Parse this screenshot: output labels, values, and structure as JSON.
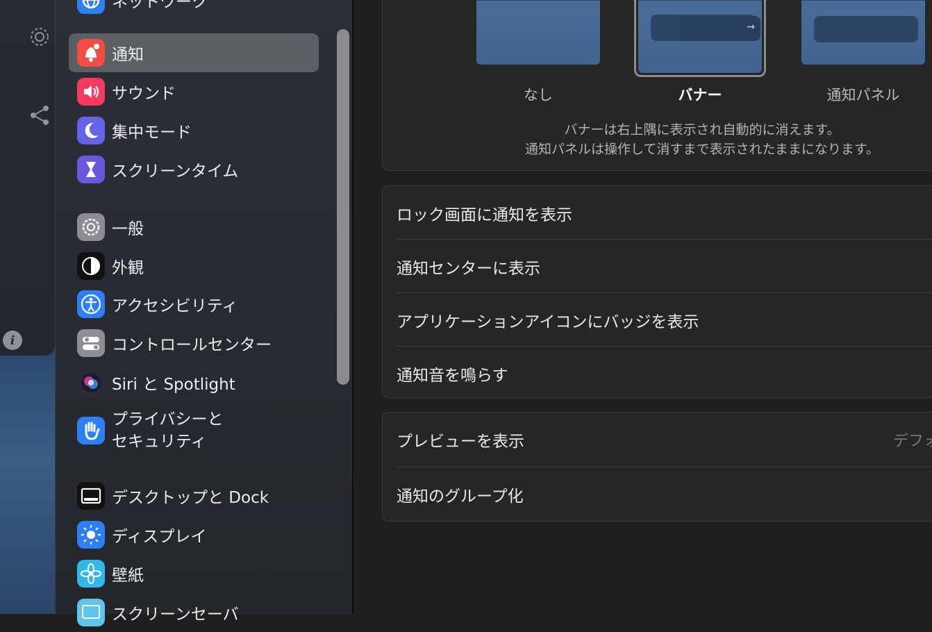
{
  "sidebar": {
    "items": [
      {
        "label": "ネットワーク",
        "icon": "globe-icon",
        "color": "#2f7ff5"
      },
      {
        "label": "通知",
        "icon": "bell-icon",
        "color": "#f24c47",
        "selected": true
      },
      {
        "label": "サウンド",
        "icon": "speaker-icon",
        "color": "#f43a5e"
      },
      {
        "label": "集中モード",
        "icon": "moon-icon",
        "color": "#6563e8"
      },
      {
        "label": "スクリーンタイム",
        "icon": "hourglass-icon",
        "color": "#6a58dc"
      },
      {
        "label": "一般",
        "icon": "gear-icon",
        "color": "#8c8c92"
      },
      {
        "label": "外観",
        "icon": "appearance-icon",
        "color": "#111111"
      },
      {
        "label": "アクセシビリティ",
        "icon": "accessibility-icon",
        "color": "#2d7ff7"
      },
      {
        "label": "コントロールセンター",
        "icon": "toggles-icon",
        "color": "#8e8e93"
      },
      {
        "label": "Siri と Spotlight",
        "icon": "siri-icon",
        "color": "#2a2a3a"
      },
      {
        "label": "プライバシーと\nセキュリティ",
        "label_line1": "プライバシーと",
        "label_line2": "セキュリティ",
        "icon": "hand-icon",
        "color": "#2d7ff7"
      },
      {
        "label": "デスクトップと Dock",
        "icon": "dock-icon",
        "color": "#111111"
      },
      {
        "label": "ディスプレイ",
        "icon": "sun-icon",
        "color": "#2d7ff7"
      },
      {
        "label": "壁紙",
        "icon": "flower-icon",
        "color": "#33b6e8"
      },
      {
        "label": "スクリーンセーバ",
        "icon": "screensaver-icon",
        "color": "#5fc5ea"
      }
    ]
  },
  "main": {
    "alert_styles": {
      "options": [
        {
          "label": "なし",
          "selected": false
        },
        {
          "label": "バナー",
          "selected": true
        },
        {
          "label": "通知パネル",
          "selected": false
        }
      ],
      "description_line1": "バナーは右上隅に表示され自動的に消えます。",
      "description_line2": "通知パネルは操作して消すまで表示されたままになります。"
    },
    "options_group": {
      "rows": [
        "ロック画面に通知を表示",
        "通知センターに表示",
        "アプリケーションアイコンにバッジを表示",
        "通知音を鳴らす"
      ]
    },
    "preview_group": {
      "show_preview_label": "プレビューを表示",
      "show_preview_value": "デフォ",
      "grouping_label": "通知のグループ化"
    }
  }
}
